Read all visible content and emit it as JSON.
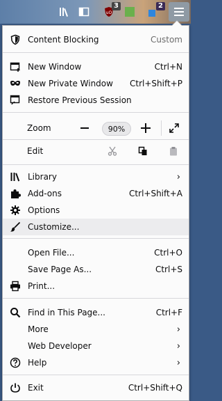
{
  "toolbar": {
    "badge_ublock": "3",
    "badge_ext": "2"
  },
  "menu": {
    "content_blocking": {
      "label": "Content Blocking",
      "value": "Custom"
    },
    "new_window": {
      "label": "New Window",
      "shortcut": "Ctrl+N"
    },
    "new_private_window": {
      "label": "New Private Window",
      "shortcut": "Ctrl+Shift+P"
    },
    "restore_session": {
      "label": "Restore Previous Session"
    },
    "zoom": {
      "label": "Zoom",
      "minus": "−",
      "value": "90%",
      "plus": "+"
    },
    "edit": {
      "label": "Edit"
    },
    "library": {
      "label": "Library",
      "chevron": "›"
    },
    "addons": {
      "label": "Add-ons",
      "shortcut": "Ctrl+Shift+A"
    },
    "options": {
      "label": "Options"
    },
    "customize": {
      "label": "Customize..."
    },
    "open_file": {
      "label": "Open File...",
      "shortcut": "Ctrl+O"
    },
    "save_page": {
      "label": "Save Page As...",
      "shortcut": "Ctrl+S"
    },
    "print": {
      "label": "Print..."
    },
    "find": {
      "label": "Find in This Page...",
      "shortcut": "Ctrl+F"
    },
    "more": {
      "label": "More",
      "chevron": "›"
    },
    "web_developer": {
      "label": "Web Developer",
      "chevron": "›"
    },
    "help": {
      "label": "Help",
      "chevron": "›"
    },
    "exit": {
      "label": "Exit",
      "shortcut": "Ctrl+Shift+Q"
    }
  },
  "colors": {
    "panel_bg": "#fbfbfb",
    "hover_bg": "#ececee",
    "separator": "#d7d7db",
    "ublock_red": "#800000"
  }
}
